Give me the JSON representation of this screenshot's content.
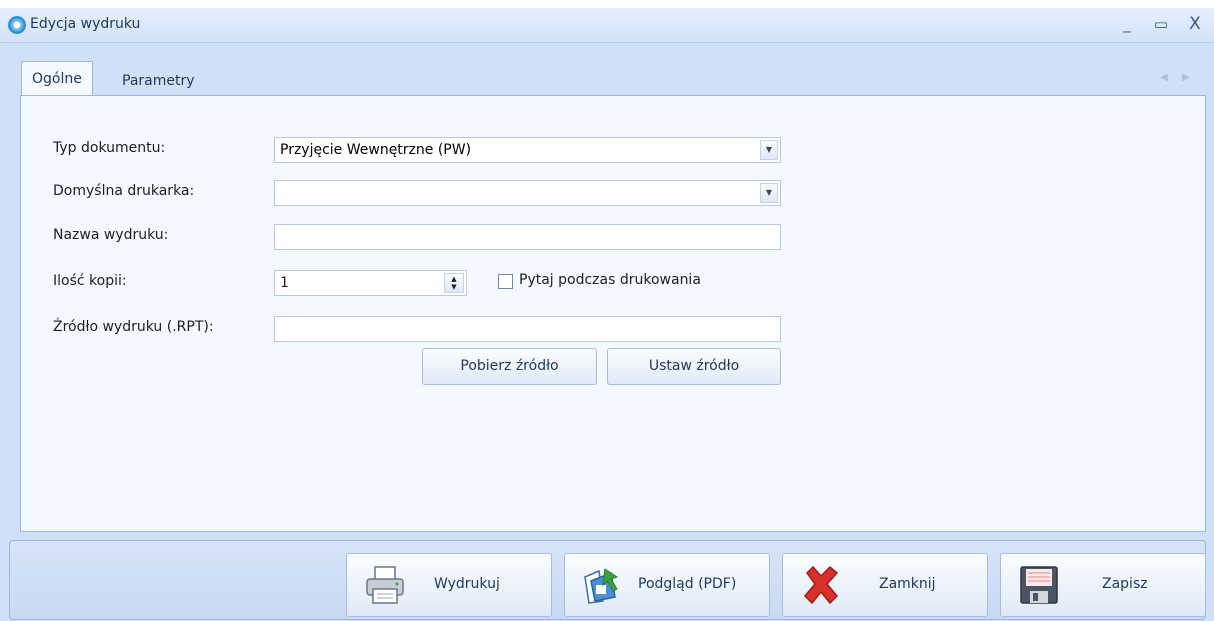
{
  "window": {
    "title": "Edycja wydruku",
    "minimize": "_",
    "maximize": "▭",
    "close": "X"
  },
  "tabs": [
    {
      "label": "Ogólne"
    },
    {
      "label": "Parametry"
    }
  ],
  "form": {
    "doc_type_label": "Typ dokumentu:",
    "doc_type_value": "Przyjęcie Wewnętrzne (PW)",
    "printer_label": "Domyślna drukarka:",
    "printer_value": "",
    "name_label": "Nazwa wydruku:",
    "name_value": "",
    "copies_label": "Ilość kopii:",
    "copies_value": "1",
    "ask_label": "Pytaj podczas drukowania",
    "ask_checked": false,
    "source_label": "Źródło wydruku (.RPT):",
    "source_value": "",
    "get_source": "Pobierz źródło",
    "set_source": "Ustaw źródło"
  },
  "footer": {
    "print": "Wydrukuj",
    "preview": "Podgląd (PDF)",
    "close": "Zamknij",
    "save": "Zapisz"
  },
  "icons": {
    "app": "app-icon",
    "print": "printer-icon",
    "preview": "pdf-preview-icon",
    "close": "red-x-icon",
    "save": "floppy-disk-icon"
  },
  "colors": {
    "accent": "#1e395b",
    "window_bg": "#cfe0f7",
    "panel_bg": "#f4f8ff",
    "close_red": "#d8302a"
  }
}
